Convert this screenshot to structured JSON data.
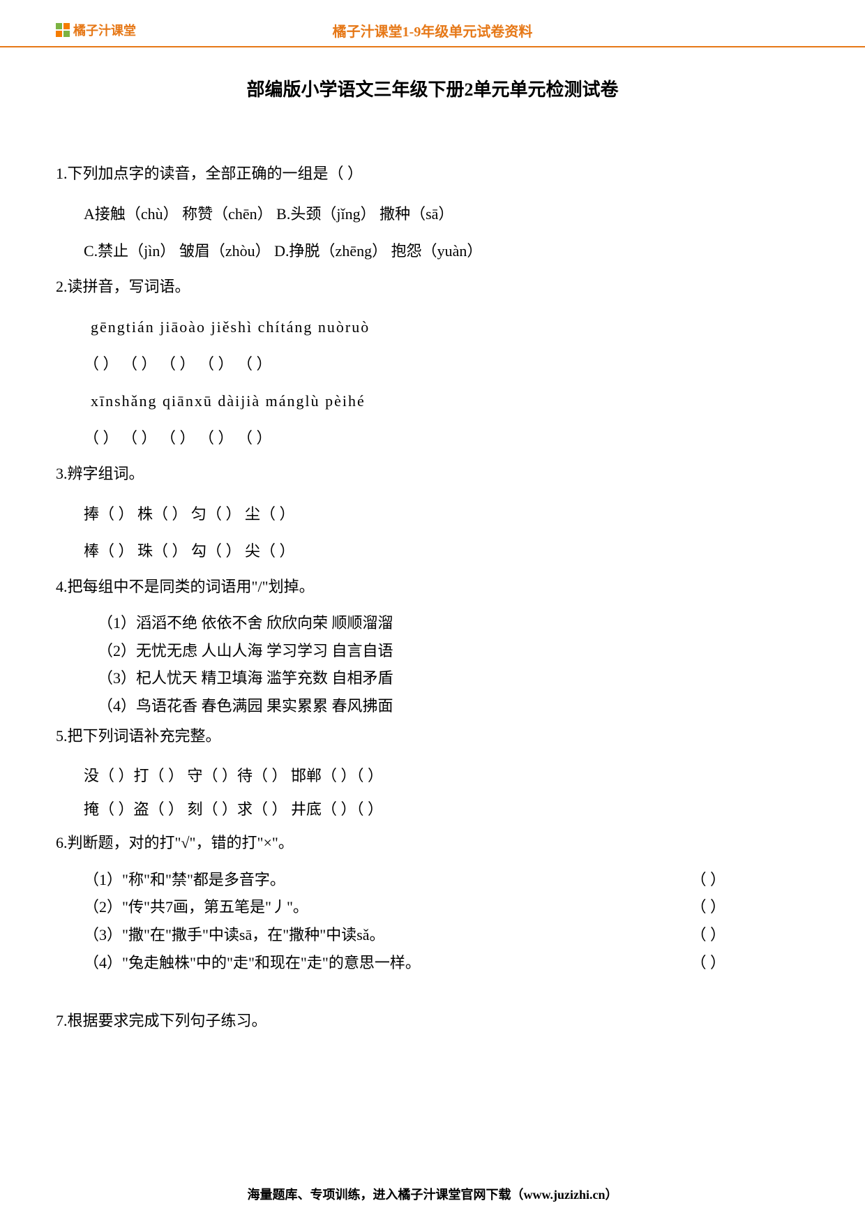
{
  "header": {
    "logo_text": "橘子汁课堂",
    "title": "橘子汁课堂1-9年级单元试卷资料"
  },
  "doc_title": "部编版小学语文三年级下册2单元单元检测试卷",
  "q1": {
    "stem": "1.下列加点字的读音，全部正确的一组是（   ）",
    "optA": "A接触（chù）  称赞（chēn）    B.头颈（jǐng）    撒种（sā）",
    "optC": "C.禁止（jìn）   皱眉（zhòu）    D.挣脱（zhēng）  抱怨（yuàn）"
  },
  "q2": {
    "stem": "2.读拼音，写词语。",
    "row1_pinyin": "gēngtián    jiāoào     jiěshì        chítáng    nuòruò",
    "row1_blank": "（        ）  （        ）  （        ）  （        ）  （        ）",
    "row2_pinyin": "xīnshǎng    qiānxū      dàijià      mánglù    pèihé",
    "row2_blank": "（        ）  （        ）  （        ）  （        ）  （        ）"
  },
  "q3": {
    "stem": "3.辨字组词。",
    "line1": "捧（        ）   株（        ）   匀（        ）   尘（        ）",
    "line2": "棒（        ）   珠（        ）   勾（        ）   尖（        ）"
  },
  "q4": {
    "stem": "4.把每组中不是同类的词语用\"/\"划掉。",
    "g1": "（1）滔滔不绝   依依不舍   欣欣向荣   顺顺溜溜",
    "g2": "（2）无忧无虑   人山人海   学习学习   自言自语",
    "g3": "（3）杞人忧天   精卫填海   滥竽充数   自相矛盾",
    "g4": "（4）鸟语花香   春色满园   果实累累   春风拂面"
  },
  "q5": {
    "stem": "5.把下列词语补充完整。",
    "line1": "没（   ）打（   ）  守（   ）待（   ）  邯郸（   ）（   ）",
    "line2": "掩（   ）盗（   ）  刻（   ）求（   ）  井底（   ）（   ）"
  },
  "q6": {
    "stem": "6.判断题，对的打\"√\"，错的打\"×\"。",
    "j1": "（1）\"称\"和\"禁\"都是多音字。",
    "j2": "（2）\"传\"共7画，第五笔是\"丿\"。",
    "j3": "（3）\"撒\"在\"撒手\"中读sā，在\"撒种\"中读sǎ。",
    "j4": "（4）\"兔走触株\"中的\"走\"和现在\"走\"的意思一样。",
    "blank": "（    ）"
  },
  "q7": {
    "stem": "7.根据要求完成下列句子练习。"
  },
  "footer": "海量题库、专项训练，进入橘子汁课堂官网下载（www.juzizhi.cn）"
}
